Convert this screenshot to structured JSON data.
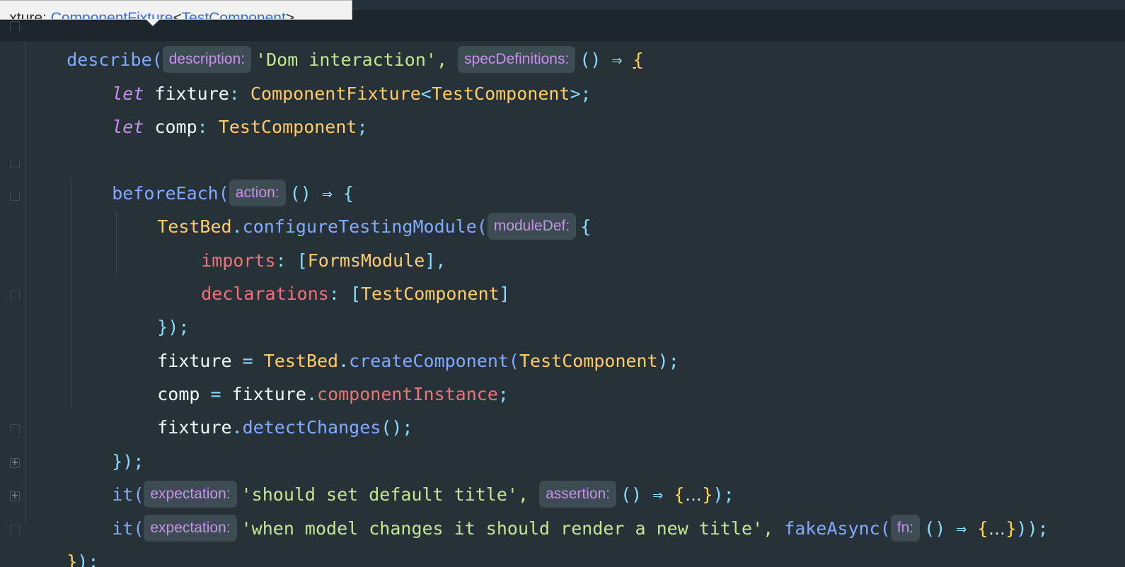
{
  "tooltip": {
    "label": "xture:",
    "type_name": "ComponentFixture",
    "lt": "<",
    "type_arg": "TestComponent",
    "gt": ">"
  },
  "colors": {
    "background": "#263238",
    "keyword": "#c792ea",
    "type": "#ffcb6b",
    "function": "#82aaff",
    "punctuation": "#89ddff",
    "property": "#f07178",
    "string": "#c3e88d",
    "hint_background": "#3d4b52"
  },
  "code": {
    "l1": {
      "fn": "describe(",
      "hint_description": "description:",
      "str": "'Dom interaction',",
      "hint_spec": "specDefinitions:",
      "arrow": "() ⇒",
      "brace": "{"
    },
    "l2": {
      "kw": "let",
      "name": "fixture",
      "colon": ":",
      "type": "ComponentFixture",
      "lt": "<",
      "type_arg": "TestComponent",
      "gt": ">;"
    },
    "l3": {
      "kw": "let",
      "name": "comp",
      "colon": ":",
      "type": "TestComponent",
      "semi": ";"
    },
    "l5": {
      "fn": "beforeEach(",
      "hint": "action:",
      "arrow": "() ⇒ {"
    },
    "l6": {
      "obj": "TestBed",
      "dot": ".",
      "fn": "configureTestingModule(",
      "hint": "moduleDef:",
      "brace": "{"
    },
    "l7": {
      "prop": "imports",
      "colon": ": [",
      "type": "FormsModule",
      "end": "],"
    },
    "l8": {
      "prop": "declarations",
      "colon": ": [",
      "type": "TestComponent",
      "end": "]"
    },
    "l9": {
      "text": "});"
    },
    "l10": {
      "name": "fixture",
      "eq": " = ",
      "obj": "TestBed",
      "dot": ".",
      "fn": "createComponent(",
      "type": "TestComponent",
      "end": ");"
    },
    "l11": {
      "name": "comp",
      "eq": " = ",
      "obj": "fixture",
      "dot": ".",
      "prop": "componentInstance",
      "semi": ";"
    },
    "l12": {
      "obj": "fixture",
      "dot": ".",
      "fn": "detectChanges",
      "end": "();"
    },
    "l13": {
      "text": "});"
    },
    "l14": {
      "fn": "it(",
      "hint_expectation": "expectation:",
      "str": "'should set default title',",
      "hint_assertion": "assertion:",
      "arrow": "() ⇒",
      "brace_open": "{",
      "ellipsis": "…",
      "brace_close": "}",
      "end": ");"
    },
    "l15": {
      "fn": "it(",
      "hint_expectation": "expectation:",
      "str": "'when model changes it should render a new title',",
      "fn2": "fakeAsync(",
      "hint_fn": "fn:",
      "arrow": "() ⇒",
      "brace_open": "{",
      "ellipsis": "…",
      "brace_close": "}",
      "end": "));"
    },
    "l16": {
      "brace": "}",
      "end": ");"
    }
  }
}
